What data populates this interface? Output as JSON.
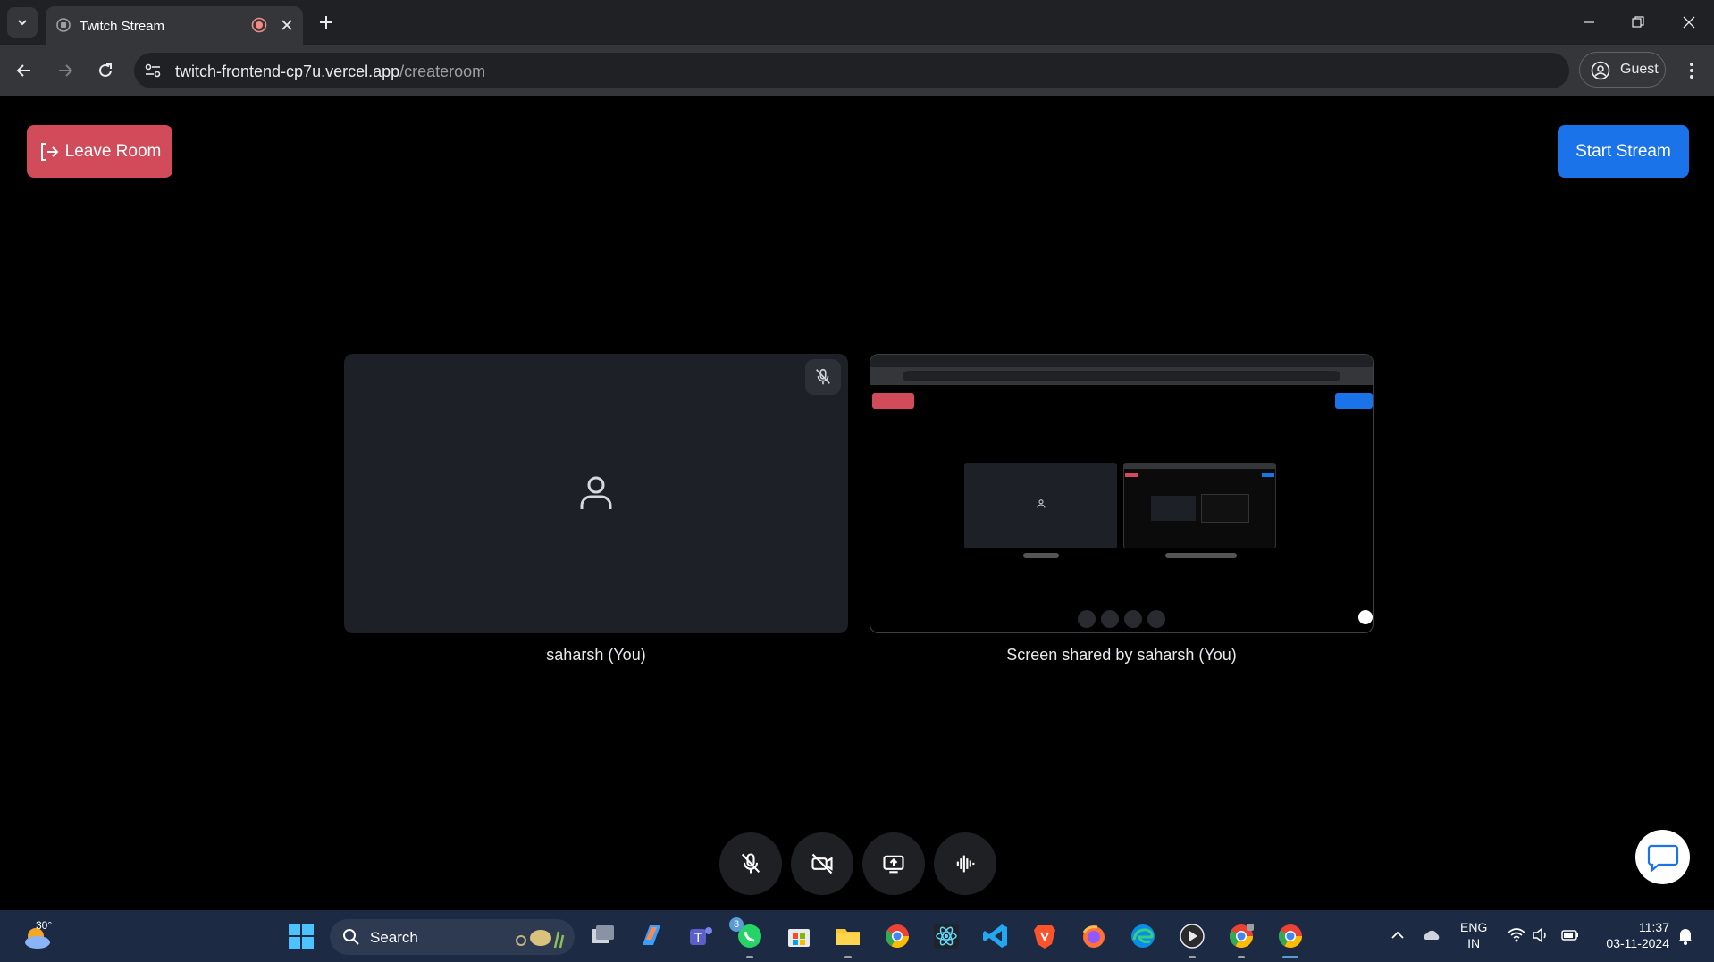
{
  "browser": {
    "tab_title": "Twitch Stream",
    "url_host": "twitch-frontend-cp7u.vercel.app",
    "url_path": "/createroom",
    "profile_label": "Guest"
  },
  "page": {
    "leave_label": "Leave Room",
    "start_label": "Start Stream",
    "tiles": [
      {
        "caption": "saharsh (You)",
        "mic_muted": true
      },
      {
        "caption": "Screen shared by saharsh (You)"
      }
    ],
    "controls": [
      "mic-off",
      "camera-off",
      "share-screen",
      "audio-waveform"
    ]
  },
  "taskbar": {
    "weather_temp": "30°",
    "search_label": "Search",
    "whatsapp_badge": "3",
    "lang_line1": "ENG",
    "lang_line2": "IN",
    "time": "11:37",
    "date": "03-11-2024"
  },
  "colors": {
    "leave": "#d14b5a",
    "start": "#1a73e8",
    "tile_bg": "#1e2028",
    "taskbar": "#1c2a44"
  }
}
